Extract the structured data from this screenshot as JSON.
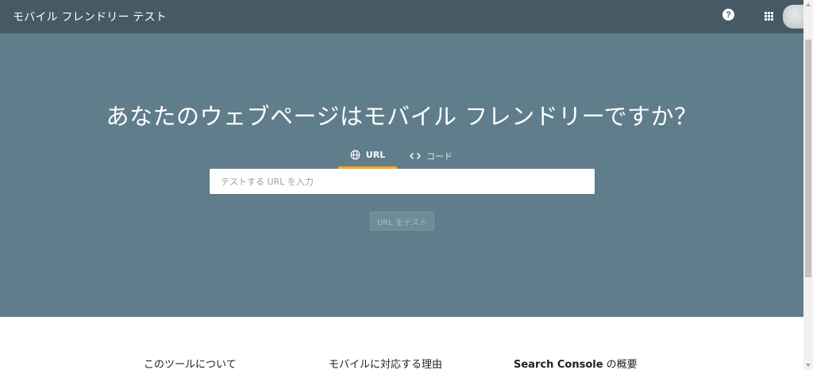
{
  "header": {
    "title": "モバイル フレンドリー テスト",
    "help_label": "?",
    "apps_icon": "apps-grid-icon",
    "avatar_icon": "account-avatar"
  },
  "hero": {
    "title": "あなたのウェブページはモバイル フレンドリーですか？",
    "tabs": [
      {
        "label": "URL",
        "icon": "globe-icon",
        "active": true
      },
      {
        "label": "コード",
        "icon": "code-brackets-icon",
        "active": false
      }
    ],
    "input_placeholder": "テストする URL を入力",
    "input_value": "",
    "test_button": "URL をテスト"
  },
  "bottom": {
    "link_about": "このツールについて",
    "link_reason": "モバイルに対応する理由",
    "link_search_console_bold": "Search Console",
    "link_search_console_rest": " の概要"
  },
  "colors": {
    "header_bg": "#455a64",
    "hero_bg": "#607d8b",
    "tab_accent": "#f9a825"
  }
}
